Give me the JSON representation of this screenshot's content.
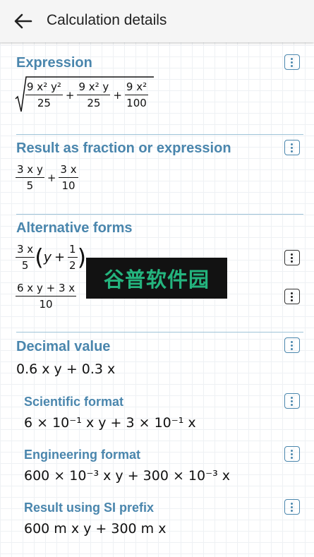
{
  "header": {
    "title": "Calculation details",
    "back_icon": "arrow-back-icon"
  },
  "sections": {
    "expression": {
      "title": "Expression",
      "terms": [
        {
          "num": "9 x² y²",
          "den": "25"
        },
        {
          "num": "9 x² y",
          "den": "25"
        },
        {
          "num": "9 x²",
          "den": "100"
        }
      ]
    },
    "result_fraction": {
      "title": "Result as fraction or expression",
      "terms": [
        {
          "num": "3 x y",
          "den": "5"
        },
        {
          "num": "3 x",
          "den": "10"
        }
      ]
    },
    "alternative_forms": {
      "title": "Alternative forms",
      "form1": {
        "coef_num": "3 x",
        "coef_den": "5",
        "var": "y",
        "plus": "+",
        "in_num": "1",
        "in_den": "2"
      },
      "form2": {
        "num": "6 x y + 3 x",
        "den": "10"
      }
    },
    "decimal": {
      "title": "Decimal value",
      "value": "0.6 x y + 0.3 x"
    },
    "scientific": {
      "title": "Scientific format",
      "value": "6 × 10⁻¹ x y + 3 × 10⁻¹ x"
    },
    "engineering": {
      "title": "Engineering format",
      "value": "600 × 10⁻³ x y + 300 × 10⁻³ x"
    },
    "si_prefix": {
      "title": "Result using SI prefix",
      "value": "600 m x y + 300 m x"
    }
  },
  "watermark": {
    "text": "谷普软件园"
  },
  "colors": {
    "accent": "#4a86ad",
    "divider": "#9fc3d8",
    "appbar": "#f5f5f5"
  }
}
